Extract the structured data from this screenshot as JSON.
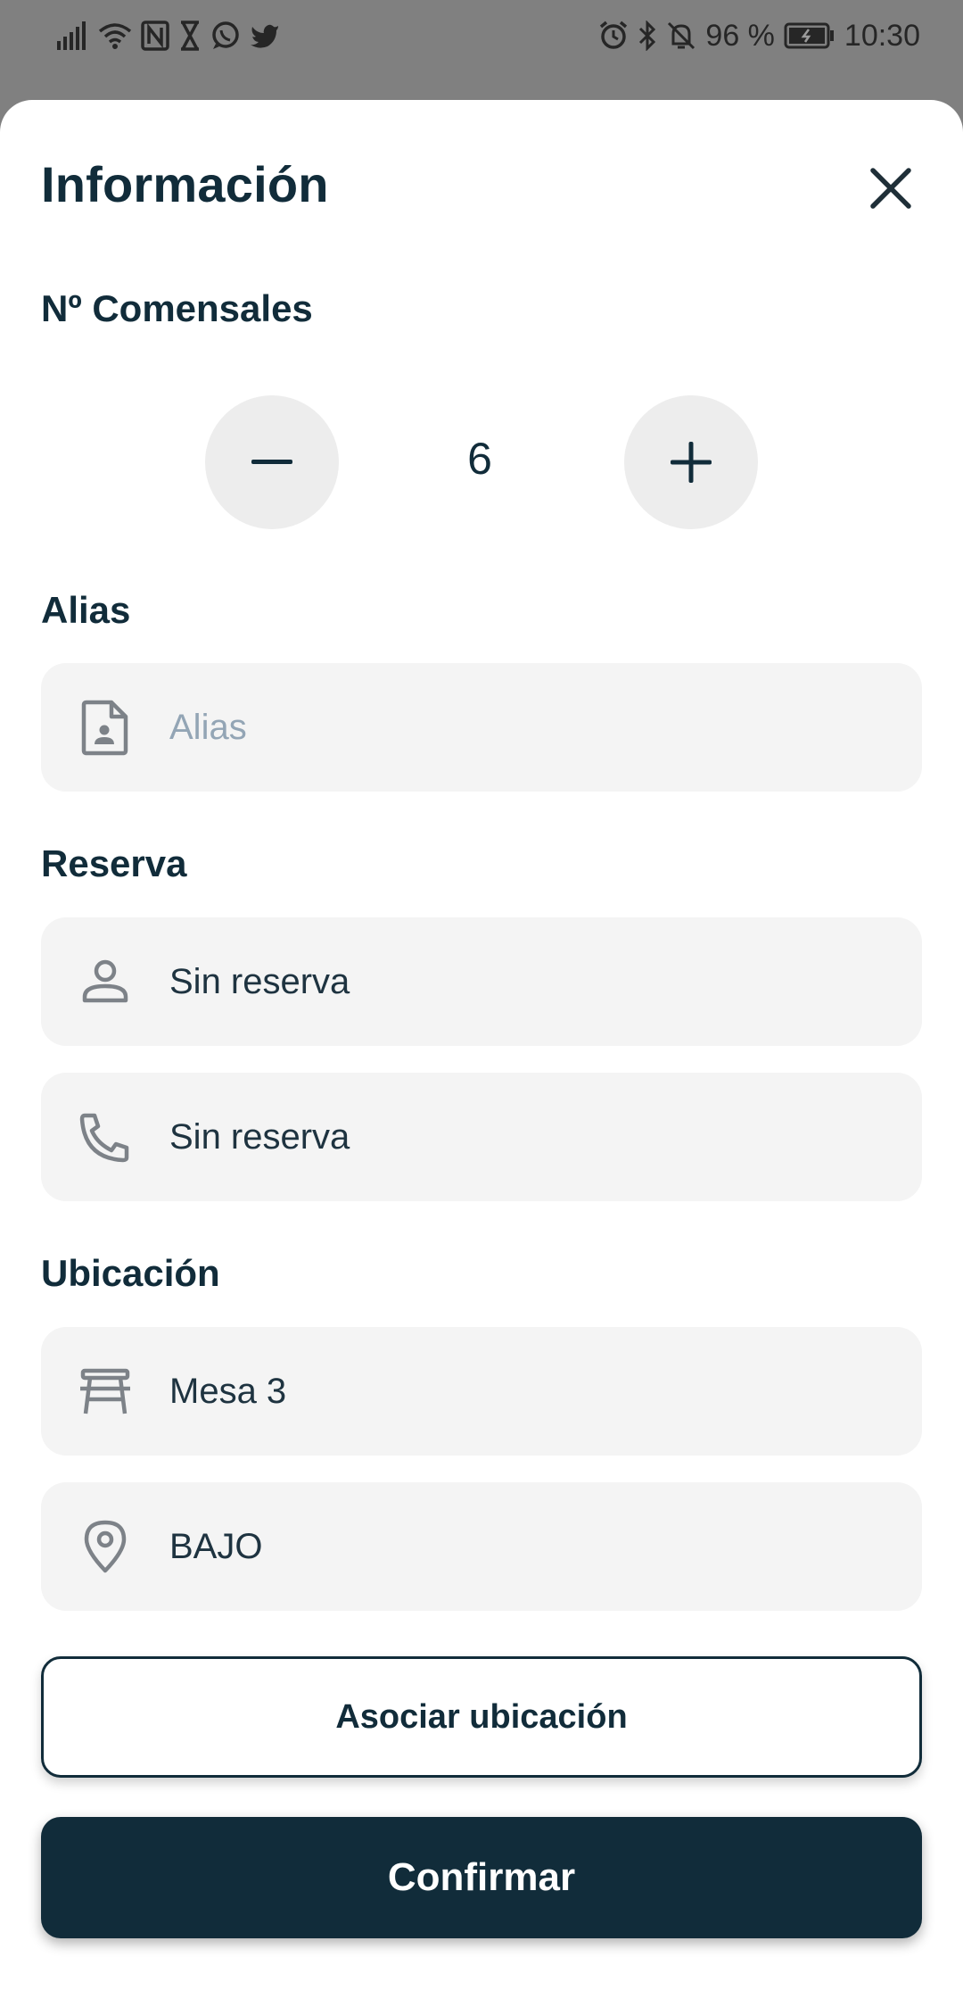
{
  "status_bar": {
    "left_icons": [
      "signal-icon",
      "wifi-icon",
      "nfc-icon",
      "hourglass-icon",
      "whatsapp-icon",
      "twitter-icon"
    ],
    "right_icons": [
      "alarm-icon",
      "bluetooth-icon",
      "mute-icon",
      "battery-icon"
    ],
    "battery": "96 %",
    "time": "10:30"
  },
  "sheet": {
    "title": "Información",
    "close_icon": "close-icon"
  },
  "diners": {
    "label": "Nº Comensales",
    "value": "6",
    "decrement_icon": "minus-icon",
    "increment_icon": "plus-icon"
  },
  "alias": {
    "label": "Alias",
    "placeholder": "Alias",
    "value": "",
    "icon": "contact-file-icon"
  },
  "reservation": {
    "label": "Reserva",
    "name": "Sin reserva",
    "name_icon": "person-icon",
    "phone": "Sin reserva",
    "phone_icon": "phone-icon"
  },
  "location": {
    "label": "Ubicación",
    "table": "Mesa 3",
    "table_icon": "table-icon",
    "zone": "BAJO",
    "zone_icon": "location-pin-icon"
  },
  "actions": {
    "associate_label": "Asociar ubicación",
    "confirm_label": "Confirmar"
  },
  "colors": {
    "primary": "#112c3a",
    "field_background": "#f4f4f4",
    "round_button_background": "#ededed",
    "placeholder": "#93a5b5",
    "icon": "#7d8288",
    "overlay": "#808080"
  }
}
